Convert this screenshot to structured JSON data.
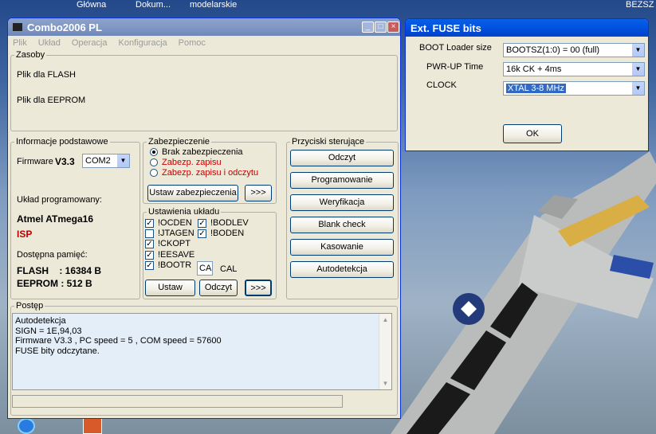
{
  "desktop": {
    "top_links": [
      "Główna",
      "Dokum...",
      "modelarskie",
      "BEZSZ"
    ]
  },
  "main_window": {
    "title": "Combo2006 PL",
    "menu": [
      "Plik",
      "Układ",
      "Operacja",
      "Konfiguracja",
      "Pomoc"
    ],
    "zasoby": {
      "legend": "Zasoby",
      "flash_label": "Plik dla FLASH",
      "eeprom_label": "Plik dla EEPROM"
    },
    "info": {
      "legend": "Informacje podstawowe",
      "firmware_label": "Firmware",
      "firmware_version": "V3.3",
      "com_value": "COM2",
      "chip_label": "Układ programowany:",
      "chip_name": "Atmel ATmega16",
      "mode": "ISP",
      "memory_label": "Dostępna pamięć:",
      "flash": "FLASH    : 16384 B",
      "eeprom": "EEPROM : 512 B"
    },
    "protection": {
      "legend": "Zabezpieczenie",
      "options": [
        "Brak zabezpieczenia",
        "Zabezp. zapisu",
        "Zabezp. zapisu i odczytu"
      ],
      "set_button": "Ustaw zabezpieczenia",
      "more_button": ">>>"
    },
    "settings": {
      "legend": "Ustawienia układu",
      "checks": [
        {
          "label": "!OCDEN",
          "checked": true
        },
        {
          "label": "!BODLEV",
          "checked": true
        },
        {
          "label": "!JTAGEN",
          "checked": false
        },
        {
          "label": "!BODEN",
          "checked": true
        },
        {
          "label": "!CKOPT",
          "checked": true
        },
        {
          "label": "!EESAVE",
          "checked": true
        },
        {
          "label": "!BOOTR",
          "checked": true
        }
      ],
      "cal_value": "CA",
      "cal_label": "CAL",
      "set_button": "Ustaw",
      "read_button": "Odczyt",
      "more_button": ">>>"
    },
    "control": {
      "legend": "Przyciski sterujące",
      "buttons": [
        "Odczyt",
        "Programowanie",
        "Weryfikacja",
        "Blank check",
        "Kasowanie",
        "Autodetekcja"
      ]
    },
    "progress": {
      "legend": "Postęp",
      "lines": [
        "Autodetekcja",
        "SIGN = 1E,94,03",
        "Firmware V3.3 , PC speed = 5  , COM speed = 57600",
        "FUSE bity odczytane."
      ],
      "progress_value": 0
    }
  },
  "fuse_window": {
    "title": "Ext. FUSE bits",
    "rows": [
      {
        "label": "BOOT Loader size",
        "value": "BOOTSZ(1:0) = 00 (full)"
      },
      {
        "label": "PWR-UP Time",
        "value": "16k CK + 4ms"
      },
      {
        "label": "CLOCK",
        "value": "XTAL 3-8 MHz"
      }
    ],
    "ok_button": "OK"
  },
  "colors": {
    "xp_blue": "#0054e3",
    "window_bg": "#ece9d8",
    "log_bg": "#e3eef9",
    "selection": "#316ac5",
    "warning_red": "#c00000"
  }
}
